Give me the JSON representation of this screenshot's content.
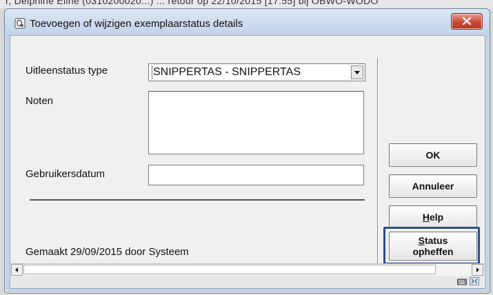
{
  "background": {
    "text": "r, Delphine Eline (0310200020...) ... retour op 22/10/2015 [17:55] bij OBWO-WODO"
  },
  "window": {
    "title": "Toevoegen of wijzigen exemplaarstatus details",
    "close_icon": "close-icon"
  },
  "form": {
    "loan_status_label": "Uitleenstatus type",
    "loan_status_value": "SNIPPERTAS - SNIPPERTAS",
    "notes_label": "Noten",
    "notes_value": "",
    "user_date_label": "Gebruikersdatum",
    "user_date_value": "",
    "created_text": "Gemaakt 29/09/2015 door Systeem"
  },
  "buttons": {
    "ok": "OK",
    "cancel": "Annuleer",
    "help_prefix": "H",
    "help_rest": "elp",
    "status_prefix": "S",
    "status_line1_rest": "tatus",
    "status_line2": "opheffen"
  },
  "colors": {
    "highlight": "#2b4e8a",
    "close_button": "#c94a37"
  }
}
